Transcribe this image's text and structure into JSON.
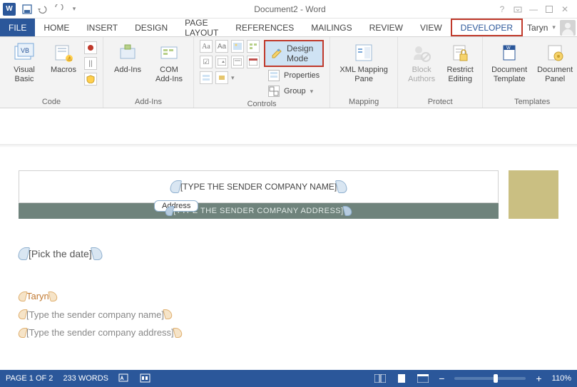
{
  "title": "Document2 - Word",
  "tabs": {
    "file": "FILE",
    "home": "HOME",
    "insert": "INSERT",
    "design": "DESIGN",
    "page_layout": "PAGE LAYOUT",
    "references": "REFERENCES",
    "mailings": "MAILINGS",
    "review": "REVIEW",
    "view": "VIEW",
    "developer": "DEVELOPER"
  },
  "account": {
    "name": "Taryn"
  },
  "ribbon": {
    "code": {
      "visual_basic": "Visual\nBasic",
      "macros": "Macros",
      "label": "Code"
    },
    "addins": {
      "addins": "Add-Ins",
      "com": "COM\nAdd-Ins",
      "label": "Add-Ins"
    },
    "controls": {
      "design_mode": "Design Mode",
      "properties": "Properties",
      "group": "Group",
      "label": "Controls"
    },
    "mapping": {
      "xml": "XML Mapping\nPane",
      "label": "Mapping"
    },
    "protect": {
      "block": "Block\nAuthors",
      "restrict": "Restrict\nEditing",
      "label": "Protect"
    },
    "templates": {
      "doc_tpl": "Document\nTemplate",
      "doc_panel": "Document\nPanel",
      "label": "Templates"
    }
  },
  "document": {
    "company_name_placeholder": "[TYPE THE SENDER COMPANY NAME]",
    "address_tab": "Address",
    "address_placeholder": "[TYPE THE SENDER COMPANY ADDRESS]",
    "date_placeholder": "[Pick the date]",
    "sender_name": "Taryn",
    "sender_company_placeholder": "[Type the sender company name]",
    "sender_address_placeholder": "[Type the sender company address]"
  },
  "status": {
    "page": "PAGE 1 OF 2",
    "words": "233 WORDS",
    "zoom": "110%"
  }
}
